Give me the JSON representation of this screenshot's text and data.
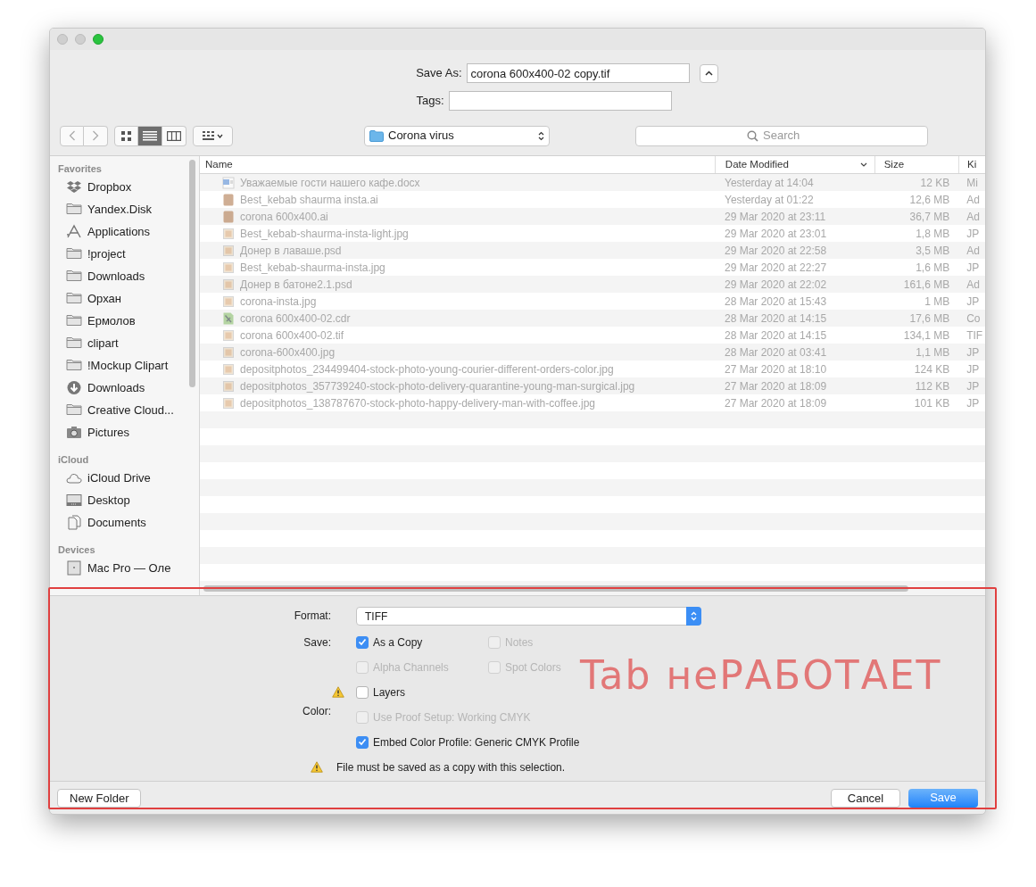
{
  "window": {
    "save_as": {
      "label": "Save As:",
      "value": "corona 600x400-02 copy.tif"
    },
    "tags": {
      "label": "Tags:"
    },
    "location": "Corona virus",
    "search": {
      "placeholder": "Search"
    },
    "view_modes": [
      {
        "kind": "icons",
        "selected": false
      },
      {
        "kind": "list",
        "selected": true
      },
      {
        "kind": "columns",
        "selected": false
      }
    ]
  },
  "sidebar": [
    {
      "heading": "Favorites",
      "items": [
        {
          "label": "Dropbox",
          "kind": "dropbox"
        },
        {
          "label": "Yandex.Disk",
          "kind": "folder"
        },
        {
          "label": "Applications",
          "kind": "apps"
        },
        {
          "label": "!project",
          "kind": "folder"
        },
        {
          "label": "Downloads",
          "kind": "folder"
        },
        {
          "label": "Орхан",
          "kind": "folder"
        },
        {
          "label": "Ермолов",
          "kind": "folder"
        },
        {
          "label": "clipart",
          "kind": "folder"
        },
        {
          "label": "!Mockup Clipart",
          "kind": "folder"
        },
        {
          "label": "Downloads",
          "kind": "download"
        },
        {
          "label": "Creative Cloud...",
          "kind": "folder"
        },
        {
          "label": "Pictures",
          "kind": "camera"
        }
      ]
    },
    {
      "heading": "iCloud",
      "items": [
        {
          "label": "iCloud Drive",
          "kind": "cloud"
        },
        {
          "label": "Desktop",
          "kind": "desktop"
        },
        {
          "label": "Documents",
          "kind": "documents"
        }
      ]
    },
    {
      "heading": "Devices",
      "items": [
        {
          "label": "Mac Pro — Оле",
          "kind": "computer"
        }
      ]
    }
  ],
  "table": {
    "columns": [
      "Name",
      "Date Modified",
      "Size",
      "Ki"
    ],
    "rows": [
      {
        "kind": "doc",
        "name": "Уважаемые гости нашего кафе.docx",
        "date": "Yesterday at 14:04",
        "size": "12 KB",
        "column_4": "Mi",
        "disabled": true
      },
      {
        "kind": "ai",
        "name": "Best_kebab shaurma insta.ai",
        "date": "Yesterday at 01:22",
        "size": "12,6 MB",
        "column_4": "Ad",
        "disabled": true
      },
      {
        "kind": "ai",
        "name": "corona 600x400.ai",
        "date": "29 Mar 2020 at 23:11",
        "size": "36,7 MB",
        "column_4": "Ad",
        "disabled": true
      },
      {
        "kind": "image",
        "name": "Best_kebab-shaurma-insta-light.jpg",
        "date": "29 Mar 2020 at 23:01",
        "size": "1,8 MB",
        "column_4": "JP",
        "disabled": true
      },
      {
        "kind": "image",
        "name": "Донер в лаваше.psd",
        "date": "29 Mar 2020 at 22:58",
        "size": "3,5 MB",
        "column_4": "Ad",
        "disabled": true
      },
      {
        "kind": "image",
        "name": "Best_kebab-shaurma-insta.jpg",
        "date": "29 Mar 2020 at 22:27",
        "size": "1,6 MB",
        "column_4": "JP",
        "disabled": true
      },
      {
        "kind": "image",
        "name": "Донер в батоне2.1.psd",
        "date": "29 Mar 2020 at 22:02",
        "size": "161,6 MB",
        "column_4": "Ad",
        "disabled": true
      },
      {
        "kind": "image",
        "name": "corona-insta.jpg",
        "date": "28 Mar 2020 at 15:43",
        "size": "1 MB",
        "column_4": "JP",
        "disabled": true
      },
      {
        "kind": "cdr",
        "name": "corona 600x400-02.cdr",
        "date": "28 Mar 2020 at 14:15",
        "size": "17,6 MB",
        "column_4": "Co",
        "disabled": true
      },
      {
        "kind": "image",
        "name": "corona 600x400-02.tif",
        "date": "28 Mar 2020 at 14:15",
        "size": "134,1 MB",
        "column_4": "TIF",
        "disabled": true
      },
      {
        "kind": "image",
        "name": "corona-600x400.jpg",
        "date": "28 Mar 2020 at 03:41",
        "size": "1,1 MB",
        "column_4": "JP",
        "disabled": true
      },
      {
        "kind": "image",
        "name": "depositphotos_234499404-stock-photo-young-courier-different-orders-color.jpg",
        "date": "27 Mar 2020 at 18:10",
        "size": "124 KB",
        "column_4": "JP",
        "disabled": true
      },
      {
        "kind": "image",
        "name": "depositphotos_357739240-stock-photo-delivery-quarantine-young-man-surgical.jpg",
        "date": "27 Mar 2020 at 18:09",
        "size": "112 KB",
        "column_4": "JP",
        "disabled": true
      },
      {
        "kind": "image",
        "name": "depositphotos_138787670-stock-photo-happy-delivery-man-with-coffee.jpg",
        "date": "27 Mar 2020 at 18:09",
        "size": "101 KB",
        "column_4": "JP",
        "disabled": true
      }
    ]
  },
  "options": {
    "format": {
      "label": "Format:",
      "value": "TIFF"
    },
    "save_label": "Save:",
    "color_label": "Color:",
    "checkboxes": [
      {
        "label": "As a Copy",
        "checked": true,
        "disabled": false,
        "warning": false
      },
      {
        "label": "Notes",
        "checked": false,
        "disabled": true,
        "warning": false
      },
      {
        "label": "Alpha Channels",
        "checked": false,
        "disabled": true,
        "warning": false
      },
      {
        "label": "Spot Colors",
        "checked": false,
        "disabled": true,
        "warning": false
      },
      {
        "label": "Layers",
        "checked": false,
        "disabled": false,
        "warning": true
      },
      {
        "label": "Use Proof Setup:  Working CMYK",
        "checked": false,
        "disabled": true,
        "warning": false
      },
      {
        "label": "Embed Color Profile:  Generic CMYK Profile",
        "checked": true,
        "disabled": false,
        "warning": false
      }
    ],
    "notice": "File must be saved as a copy with this selection."
  },
  "buttons": {
    "new_folder": "New Folder",
    "cancel": "Cancel",
    "save": "Save"
  },
  "annotation": {
    "text": "Tab неРАБОТАЕТ"
  }
}
